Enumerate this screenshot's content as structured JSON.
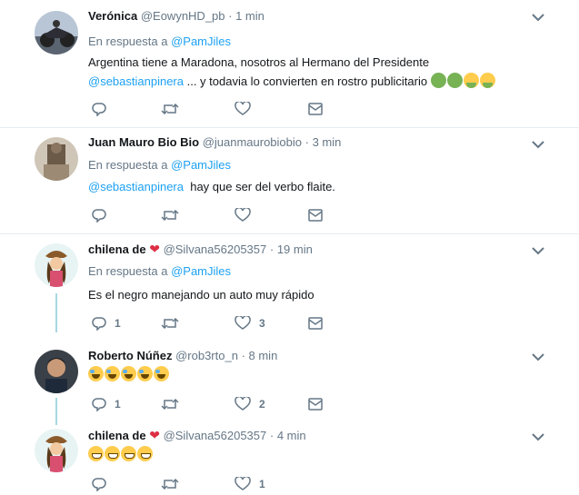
{
  "tweets": [
    {
      "name": "Verónica",
      "handle": "@EowynHD_pb",
      "time": "· 1 min",
      "reply_prefix": "En respuesta a",
      "reply_to": "@PamJiles",
      "line1": "Argentina tiene a Maradona, nosotros al Hermano del Presidente",
      "mention": "@sebastianpinera",
      "line2": " ... y todavia lo convierten en rostro publicitario",
      "emojis": [
        "sick",
        "sick",
        "vomit",
        "vomit"
      ],
      "reply_count": "",
      "retweet_count": "",
      "like_count": ""
    },
    {
      "name": "Juan Mauro Bio Bio",
      "handle": "@juanmaurobiobio",
      "time": "· 3 min",
      "reply_prefix": "En respuesta a",
      "reply_to": "@PamJiles",
      "mention": "@sebastianpinera",
      "line2": "  hay que ser del verbo flaite.",
      "reply_count": "",
      "retweet_count": "",
      "like_count": ""
    },
    {
      "name": "chilena de",
      "handle": "@Silvana56205357",
      "time": "· 19 min",
      "reply_prefix": "En respuesta a",
      "reply_to": "@PamJiles",
      "text": "Es el negro manejando un auto muy rápido",
      "reply_count": "1",
      "retweet_count": "",
      "like_count": "3"
    },
    {
      "name": "Roberto Núñez",
      "handle": "@rob3rto_n",
      "time": "· 8 min",
      "emojis": [
        "cry",
        "cry",
        "cry",
        "cry",
        "cry"
      ],
      "reply_count": "1",
      "retweet_count": "",
      "like_count": "2"
    },
    {
      "name": "chilena de",
      "handle": "@Silvana56205357",
      "time": "· 4 min",
      "emojis": [
        "grin",
        "grin",
        "grin",
        "grin"
      ],
      "reply_count": "",
      "retweet_count": "",
      "like_count": "1"
    }
  ],
  "colors": {
    "link": "#1da1f2",
    "muted": "#657786",
    "thread": "#a6d8e0",
    "heart": "#dd2e44"
  },
  "icons": {
    "reply": "reply-icon",
    "retweet": "retweet-icon",
    "like": "heart-icon",
    "dm": "envelope-icon",
    "more": "chevron-down-icon"
  }
}
